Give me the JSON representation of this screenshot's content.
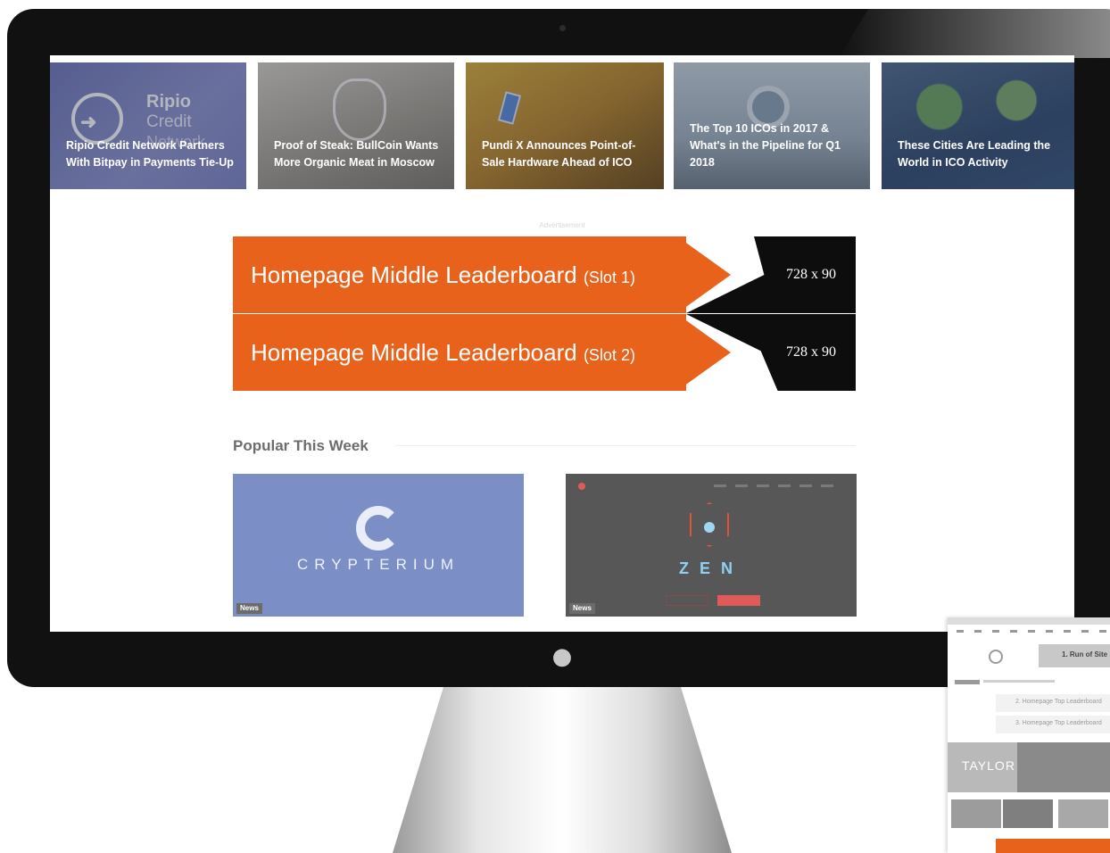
{
  "screen": {
    "hero_cards": [
      {
        "title": "Ripio Credit Network Partners With Bitpay in Payments Tie-Up",
        "brand_line1": "Ripio",
        "brand_line2": "Credit",
        "brand_line3": "Network"
      },
      {
        "title": "Proof of Steak: BullCoin Wants More Organic Meat in Moscow"
      },
      {
        "title": "Pundi X Announces Point-of-Sale Hardware Ahead of ICO"
      },
      {
        "title": "The Top 10 ICOs in 2017 & What's in the Pipeline for Q1 2018"
      },
      {
        "title": "These Cities Are Leading the World in ICO Activity"
      }
    ],
    "ad_caption": "Advertisement",
    "ads": [
      {
        "label": "Homepage Middle Leaderboard",
        "slot": "(Slot 1)",
        "size": "728 x 90"
      },
      {
        "label": "Homepage Middle Leaderboard",
        "slot": "(Slot 2)",
        "size": "728 x 90"
      }
    ],
    "section_title": "Popular This Week",
    "popular": [
      {
        "brand": "CRYPTERIUM",
        "tag": "News"
      },
      {
        "brand": "ZEN",
        "tag": "News"
      }
    ]
  },
  "inset": {
    "button_label": "1. Run of Site",
    "slots": [
      "2. Homepage Top Leaderboard",
      "3. Homepage Top Leaderboard"
    ],
    "brand": "TAYLOR"
  },
  "colors": {
    "accent_orange": "#e8621c",
    "bezel": "#111111",
    "crypterium_bg": "#7b8fc6"
  }
}
